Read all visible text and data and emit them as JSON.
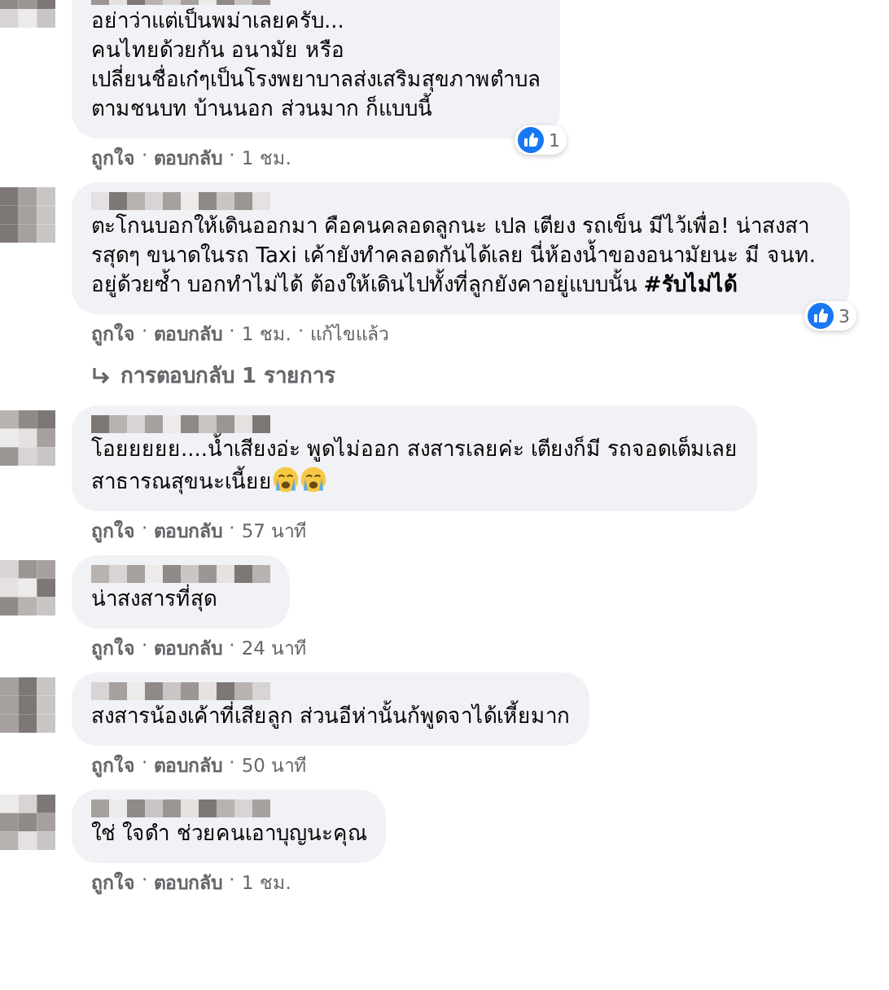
{
  "comments": [
    {
      "text": "อย่าว่าแต่เป็นพม่าเลยครับ...\nคนไทยด้วยกัน อนามัย หรือ\nเปลี่ยนชื่อเก๋ๆเป็นโรงพยาบาลส่งเสริมสุขภาพตำบล\nตามชนบท บ้านนอก ส่วนมาก ก็แบบนี้",
      "reaction_count": "1",
      "meta": [
        {
          "kind": "link",
          "label": "ถูกใจ"
        },
        {
          "kind": "separator",
          "label": "·"
        },
        {
          "kind": "link",
          "label": "ตอบกลับ"
        },
        {
          "kind": "separator",
          "label": "·"
        },
        {
          "kind": "time",
          "label": "1 ชม."
        }
      ]
    },
    {
      "text": "ตะโกนบอกให้เดินออกมา คือคนคลอดลูกนะ เปล เตียง รถเข็น มีไว้เพื่อ! น่าสงสารสุดๆ ขนาดในรถ Taxi เค้ายังทำคลอดกันได้เลย นี่ห้องน้ำของอนามัยนะ มี จนท. อยู่ด้วยซ้ำ บอกทำไม่ได้ ต้องให้เดินไปทั้งที่ลูกยังคาอยู่แบบนั้น **#รับไม่ได้**",
      "reaction_count": "3",
      "meta": [
        {
          "kind": "link",
          "label": "ถูกใจ"
        },
        {
          "kind": "separator",
          "label": "·"
        },
        {
          "kind": "link",
          "label": "ตอบกลับ"
        },
        {
          "kind": "separator",
          "label": "·"
        },
        {
          "kind": "time",
          "label": "1 ชม."
        },
        {
          "kind": "separator",
          "label": "·"
        },
        {
          "kind": "time",
          "label": "แก้ไขแล้ว"
        }
      ],
      "replies_link": "การตอบกลับ 1 รายการ"
    },
    {
      "text": "โอยยยยย....น้ำเสียงอ่ะ พูดไม่ออก สงสารเลยค่ะ เตียงก็มี รถจอดเต็มเลย\nสาธารณสุขนะเนี้ยย",
      "trailing_icons": [
        {
          "kind": "crying"
        },
        {
          "kind": "crying"
        }
      ],
      "meta": [
        {
          "kind": "link",
          "label": "ถูกใจ"
        },
        {
          "kind": "separator",
          "label": "·"
        },
        {
          "kind": "link",
          "label": "ตอบกลับ"
        },
        {
          "kind": "separator",
          "label": "·"
        },
        {
          "kind": "time",
          "label": "57 นาที"
        }
      ]
    },
    {
      "text": "น่าสงสารที่สุด",
      "meta": [
        {
          "kind": "link",
          "label": "ถูกใจ"
        },
        {
          "kind": "separator",
          "label": "·"
        },
        {
          "kind": "link",
          "label": "ตอบกลับ"
        },
        {
          "kind": "separator",
          "label": "·"
        },
        {
          "kind": "time",
          "label": "24 นาที"
        }
      ]
    },
    {
      "text": "สงสารน้องเค้าที่เสียลูก ส่วนอีห่านั้นก้พูดจาได้เหี้ยมาก",
      "meta": [
        {
          "kind": "link",
          "label": "ถูกใจ"
        },
        {
          "kind": "separator",
          "label": "·"
        },
        {
          "kind": "link",
          "label": "ตอบกลับ"
        },
        {
          "kind": "separator",
          "label": "·"
        },
        {
          "kind": "time",
          "label": "50 นาที"
        }
      ]
    },
    {
      "text": "ใช่ ใจดำ ช่วยคนเอาบุญนะคุณ",
      "meta": [
        {
          "kind": "link",
          "label": "ถูกใจ"
        },
        {
          "kind": "separator",
          "label": "·"
        },
        {
          "kind": "link",
          "label": "ตอบกลับ"
        },
        {
          "kind": "separator",
          "label": "·"
        },
        {
          "kind": "time",
          "label": "1 ชม."
        }
      ]
    }
  ]
}
